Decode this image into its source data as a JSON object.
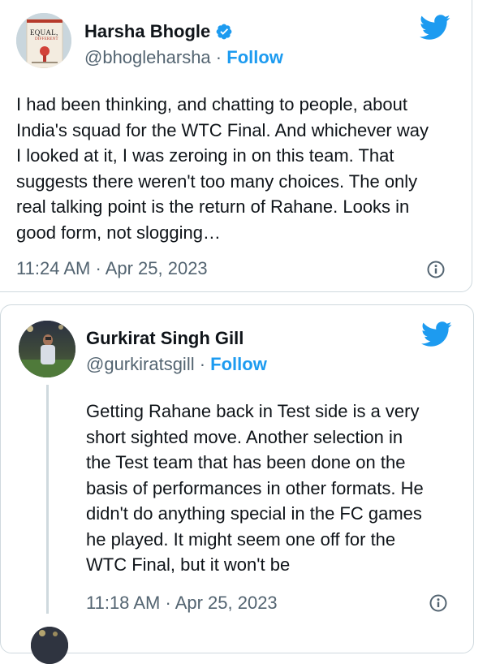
{
  "tweets": [
    {
      "author": {
        "name": "Harsha Bhogle",
        "handle": "@bhogleharsha",
        "verified": true,
        "follow_label": "Follow",
        "avatar_book_title": "EQUAL,",
        "avatar_book_subtitle": "DIFFERENT"
      },
      "text_lines": [
        "I had been thinking, and chatting to people, about",
        "India's squad for the WTC Final. And whichever way",
        "I looked at it, I was zeroing in on this team. That",
        "suggests there weren't too many choices. The only",
        "real talking point is the return of Rahane. Looks in",
        "good form, not slogging…"
      ],
      "time": "11:24 AM",
      "date": "Apr 25, 2023"
    },
    {
      "author": {
        "name": "Gurkirat Singh Gill",
        "handle": "@gurkiratsgill",
        "follow_label": "Follow"
      },
      "text_lines": [
        "Getting Rahane back in Test side is a very",
        "short sighted move. Another selection in",
        "the Test team that has been done on the",
        "basis of performances in other formats. He",
        "didn't do anything special in the FC games",
        "he played. It might seem one off for the",
        "WTC Final, but it won't be"
      ],
      "time": "11:18 AM",
      "date": "Apr 25, 2023"
    }
  ],
  "separator": "·",
  "icons": {
    "brand": "twitter-bird-icon",
    "verified": "verified-badge-icon",
    "info": "info-icon"
  },
  "colors": {
    "accent": "#1d9bf0",
    "text": "#0f1419",
    "muted": "#536471",
    "border": "#cfd9de"
  }
}
